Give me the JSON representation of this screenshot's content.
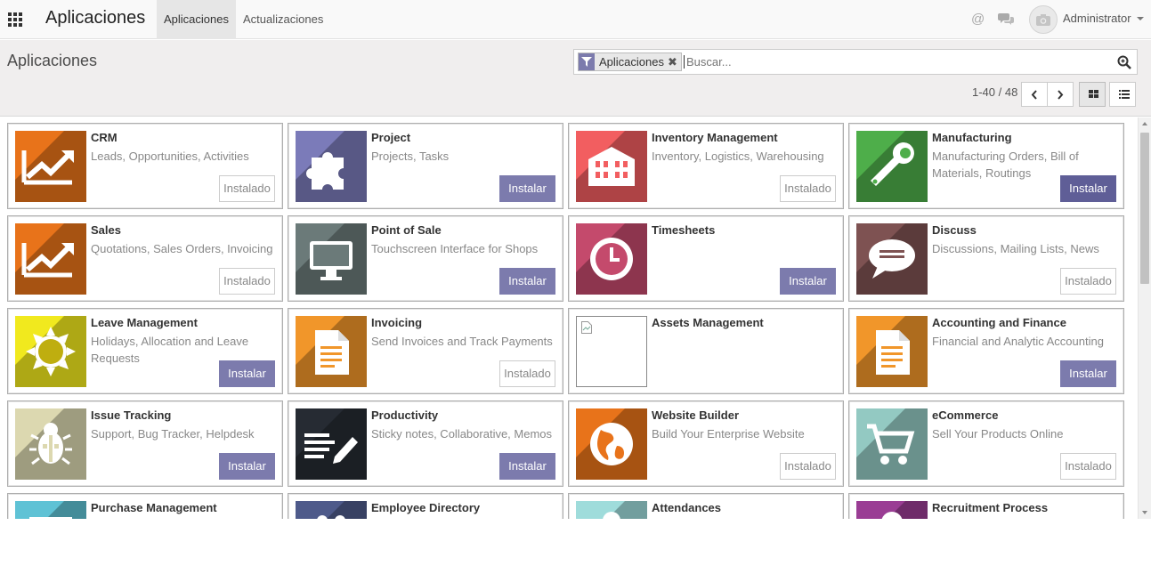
{
  "topbar": {
    "brand": "Aplicaciones",
    "menu": [
      "Aplicaciones",
      "Actualizaciones"
    ],
    "user": "Administrator"
  },
  "control": {
    "title": "Aplicaciones",
    "facet": "Aplicaciones",
    "search_placeholder": "Buscar...",
    "pager": "1-40 / 48"
  },
  "apps": [
    {
      "name": "CRM",
      "summary": "Leads, Opportunities, Activities",
      "button": "Instalado",
      "state": "installed",
      "color": "#e8731a",
      "icon": "chart-icon"
    },
    {
      "name": "Project",
      "summary": "Projects, Tasks",
      "button": "Instalar",
      "state": "install",
      "color": "#7b7bb9",
      "icon": "puzzle-icon"
    },
    {
      "name": "Inventory Management",
      "summary": "Inventory, Logistics, Warehousing",
      "button": "Instalado",
      "state": "installed",
      "color": "#f25e60",
      "icon": "building-icon"
    },
    {
      "name": "Manufacturing",
      "summary": "Manufacturing Orders, Bill of Materials, Routings",
      "button": "Instalar",
      "state": "install-dark",
      "color": "#4eae4a",
      "icon": "wrench-icon"
    },
    {
      "name": "Sales",
      "summary": "Quotations, Sales Orders, Invoicing",
      "button": "Instalado",
      "state": "installed",
      "color": "#e8731a",
      "icon": "chart-icon"
    },
    {
      "name": "Point of Sale",
      "summary": "Touchscreen Interface for Shops",
      "button": "Instalar",
      "state": "install",
      "color": "#6b7a79",
      "icon": "monitor-icon"
    },
    {
      "name": "Timesheets",
      "summary": "",
      "button": "Instalar",
      "state": "install",
      "color": "#c44a6c",
      "icon": "clock-icon"
    },
    {
      "name": "Discuss",
      "summary": "Discussions, Mailing Lists, News",
      "button": "Instalado",
      "state": "installed",
      "color": "#7e5252",
      "icon": "speech-bubble-icon"
    },
    {
      "name": "Leave Management",
      "summary": "Holidays, Allocation and Leave Requests",
      "button": "Instalar",
      "state": "install",
      "color": "#f1e91e",
      "icon": "sun-icon"
    },
    {
      "name": "Invoicing",
      "summary": "Send Invoices and Track Payments",
      "button": "Instalado",
      "state": "installed",
      "color": "#f1962a",
      "icon": "document-icon"
    },
    {
      "name": "Assets Management",
      "summary": "",
      "button": "",
      "state": "none",
      "color": "#ffffff",
      "icon": "broken-image-icon"
    },
    {
      "name": "Accounting and Finance",
      "summary": "Financial and Analytic Accounting",
      "button": "Instalar",
      "state": "install",
      "color": "#f1962a",
      "icon": "document-icon"
    },
    {
      "name": "Issue Tracking",
      "summary": "Support, Bug Tracker, Helpdesk",
      "button": "Instalar",
      "state": "install",
      "color": "#dcd8b0",
      "icon": "bug-icon"
    },
    {
      "name": "Productivity",
      "summary": "Sticky notes, Collaborative, Memos",
      "button": "Instalar",
      "state": "install",
      "color": "#262b33",
      "icon": "notes-pencil-icon"
    },
    {
      "name": "Website Builder",
      "summary": "Build Your Enterprise Website",
      "button": "Instalado",
      "state": "installed",
      "color": "#e8731a",
      "icon": "globe-icon"
    },
    {
      "name": "eCommerce",
      "summary": "Sell Your Products Online",
      "button": "Instalado",
      "state": "installed",
      "color": "#93c9c2",
      "icon": "cart-icon"
    },
    {
      "name": "Purchase Management",
      "summary": "",
      "button": "",
      "state": "none",
      "color": "#5fc2d5",
      "icon": "purchase-icon"
    },
    {
      "name": "Employee Directory",
      "summary": "",
      "button": "",
      "state": "none",
      "color": "#4e5a8a",
      "icon": "employees-icon"
    },
    {
      "name": "Attendances",
      "summary": "",
      "button": "",
      "state": "none",
      "color": "#9fdcdb",
      "icon": "attendance-icon"
    },
    {
      "name": "Recruitment Process",
      "summary": "",
      "button": "",
      "state": "none",
      "color": "#9a3d94",
      "icon": "recruitment-icon"
    }
  ]
}
